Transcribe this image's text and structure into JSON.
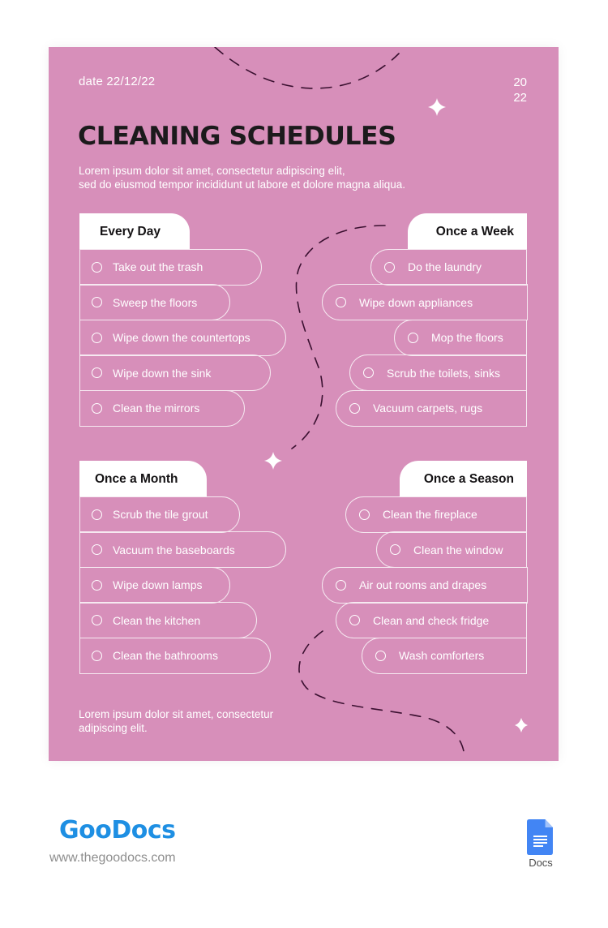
{
  "document": {
    "date": "date 22/12/22",
    "year_top": "20",
    "year_bottom": "22",
    "title": "CLEANING SCHEDULES",
    "intro_line1": "Lorem ipsum dolor sit amet, consectetur adipiscing elit,",
    "intro_line2": "sed do eiusmod tempor incididunt ut labore et dolore magna aliqua.",
    "outro_line1": "Lorem ipsum dolor sit amet, consectetur",
    "outro_line2": "adipiscing elit.",
    "colors": {
      "background": "#d78fba",
      "header_fill": "#ffffff",
      "title": "#1c1a1c",
      "dashed_line": "#3a1030"
    }
  },
  "schedules": {
    "every_day": {
      "heading": "Every Day",
      "items": [
        "Take out the trash",
        "Sweep the floors",
        "Wipe down the countertops",
        "Wipe down the sink",
        "Clean the mirrors"
      ]
    },
    "once_a_week": {
      "heading": "Once a Week",
      "items": [
        "Do the laundry",
        "Wipe down appliances",
        "Mop the floors",
        "Scrub the toilets, sinks",
        "Vacuum carpets, rugs"
      ]
    },
    "once_a_month": {
      "heading": "Once a Month",
      "items": [
        "Scrub the tile grout",
        "Vacuum the baseboards",
        "Wipe down lamps",
        "Clean the kitchen",
        "Clean the bathrooms"
      ]
    },
    "once_a_season": {
      "heading": "Once a Season",
      "items": [
        "Clean the fireplace",
        "Clean the window",
        "Air out rooms and drapes",
        "Clean and check fridge",
        "Wash comforters"
      ]
    }
  },
  "footer": {
    "brand": "GooDocs",
    "website": "www.thegoodocs.com",
    "app_label": "Docs",
    "app_icon": "google-docs-icon"
  }
}
